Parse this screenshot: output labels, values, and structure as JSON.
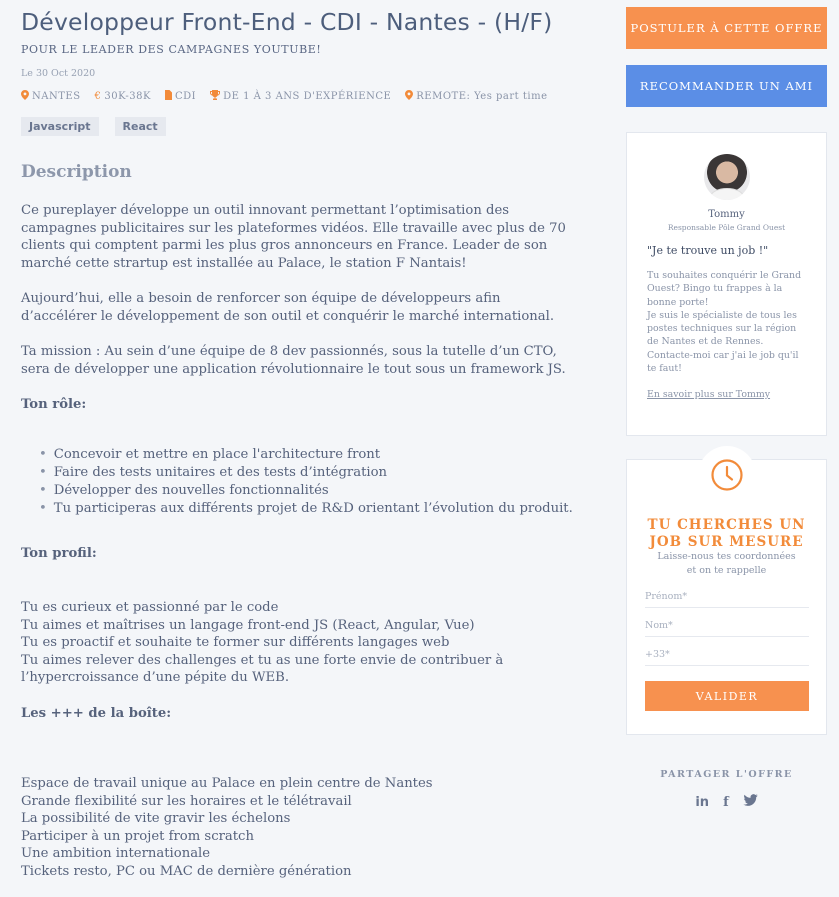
{
  "job": {
    "title": "Développeur Front-End - CDI - Nantes - (H/F)",
    "subtitle": "POUR LE LEADER DES CAMPAGNES YOUTUBE!",
    "date": "Le 30 Oct 2020",
    "meta": {
      "location": "NANTES",
      "salary": "30K-38K",
      "contract": "CDI",
      "experience": "DE 1 À 3 ANS D'EXPÉRIENCE",
      "remote": "REMOTE: Yes part time"
    },
    "tags": [
      "Javascript",
      "React"
    ]
  },
  "description": {
    "heading": "Description",
    "para1_lines": [
      "Ce pureplayer développe un outil innovant permettant l’optimisation des",
      "campagnes publicitaires sur les plateformes vidéos. Elle travaille avec plus de 70",
      "clients qui comptent parmi les plus gros annonceurs en France. Leader de son",
      "marché cette strartup est installée au Palace, le station F Nantais!"
    ],
    "para2_lines": [
      "Aujourd’hui, elle a besoin de renforcer son équipe de développeurs afin",
      "d’accélérer le développement de son outil et conquérir le marché international."
    ],
    "para3_lines": [
      "Ta mission : Au sein d’une équipe de 8 dev passionnés, sous la tutelle d’un CTO,",
      "sera de développer une application révolutionnaire le tout sous un framework JS."
    ],
    "role_heading": "Ton rôle:",
    "role_items": [
      "Concevoir et mettre en place l'architecture front",
      "Faire des tests unitaires et des tests d’intégration",
      "Développer des nouvelles fonctionnalités",
      "Tu participeras aux différents projet de R&D orientant l’évolution du produit."
    ],
    "profile_heading": "Ton profil:",
    "profile_lines": [
      "Tu es curieux et passionné par le code",
      "Tu aimes et maîtrises un langage front-end JS (React, Angular, Vue)",
      "Tu es proactif et souhaite te former sur différents langages web",
      "Tu aimes relever des challenges et tu as une forte envie de contribuer à",
      "l’hypercroissance d’une pépite du WEB."
    ],
    "perks_heading": "Les +++  de la boîte:",
    "perks_lines": [
      "Espace de travail unique au Palace en plein centre de Nantes",
      "Grande flexibilité sur les horaires et le télétravail",
      "La possibilité de vite gravir les échelons",
      "Participer à un projet from scratch",
      "Une ambition internationale",
      "Tickets resto, PC ou MAC de dernière génération"
    ]
  },
  "sidebar": {
    "apply_label": "POSTULER À CETTE OFFRE",
    "recommend_label": "RECOMMANDER UN AMI",
    "recruiter": {
      "name": "Tommy",
      "role": "Responsable Pôle Grand Ouest",
      "quote": "\"Je te trouve un job !\"",
      "desc_lines": [
        "Tu souhaites conquérir le Grand",
        "Ouest? Bingo tu frappes à la",
        "bonne porte!",
        "Je suis le spécialiste de tous les",
        "postes techniques sur la région",
        "de Nantes et de Rennes.",
        "Contacte-moi car j'ai le job qu'il",
        "te faut!"
      ],
      "link_label": "En savoir plus sur Tommy"
    },
    "form": {
      "title_line1": "TU CHERCHES UN",
      "title_line2": "JOB SUR MESURE",
      "sub_line1": "Laisse-nous tes coordonnées",
      "sub_line2": "et on te rappelle",
      "firstname_placeholder": "Prénom*",
      "lastname_placeholder": "Nom*",
      "phone_placeholder": "+33*",
      "submit_label": "VALIDER"
    },
    "share": {
      "label": "PARTAGER L'OFFRE",
      "linkedin": "in",
      "facebook": "f"
    }
  },
  "colors": {
    "accent_orange": "#f7914f",
    "accent_blue": "#5b8ee6"
  }
}
